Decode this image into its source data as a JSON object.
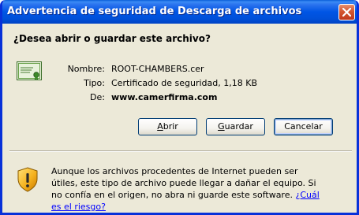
{
  "window": {
    "title": "Advertencia de seguridad de Descarga de archivos"
  },
  "question": "¿Desea abrir o guardar este archivo?",
  "file": {
    "name_label": "Nombre:",
    "name_value": "ROOT-CHAMBERS.cer",
    "type_label": "Tipo:",
    "type_value": "Certificado de seguridad, 1,18 KB",
    "from_label": "De:",
    "from_value": "www.camerfirma.com",
    "icon": "certificate-icon"
  },
  "buttons": {
    "open_first": "A",
    "open_rest": "brir",
    "save_first": "G",
    "save_rest": "uardar",
    "cancel": "Cancelar"
  },
  "warning": {
    "icon": "shield-warning-icon",
    "text": "Aunque los archivos procedentes de Internet pueden ser útiles, este tipo de archivo puede llegar a dañar el equipo. Si no confía en el origen, no abra ni guarde este software.",
    "link": "¿Cuál es el riesgo?"
  },
  "colors": {
    "titlebar": "#0055e5",
    "window_bg": "#ece9d8",
    "link": "#0000ff",
    "close": "#c0391b"
  }
}
